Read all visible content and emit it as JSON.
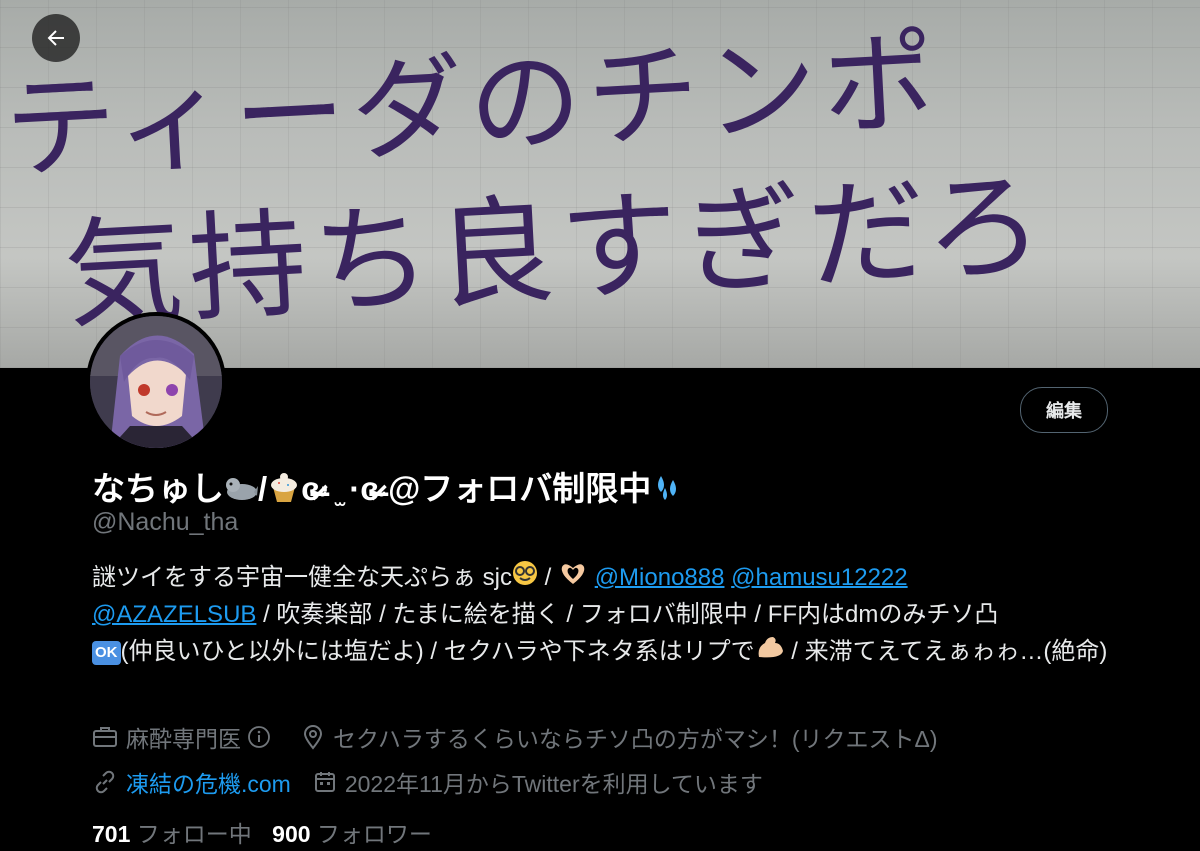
{
  "banner": {
    "line1": "ティーダのチンポ",
    "line2": "気持ち良すぎだろ"
  },
  "actions": {
    "edit_label": "編集"
  },
  "profile": {
    "name_part1": "なちゅし",
    "name_part2": "/",
    "name_part3": "ɞ̴̶̷· ̫ ·ɞ̴̶̷ @フォロバ制限中",
    "handle": "@Nachu_tha",
    "bio": {
      "t1": "謎ツイをする宇宙一健全な天ぷらぁ sjc",
      "t2": " / ",
      "mention1": "@Miono888",
      "mention2": "@hamusu12222",
      "mention3": "@AZAZELSUB",
      "t3": " / 吹奏楽部 / たまに絵を描く / フォロバ制限中 / FF内はdmのみチソ凸",
      "ok": "OK",
      "t4": "(仲良いひと以外には塩だよ) / セクハラや下ネタ系はリプで",
      "t5": " / 来滞てえてえぁゎゎ…(絶命)"
    },
    "job": "麻酔専門医",
    "location": "セクハラするくらいならチソ凸の方がマシ！(リクエストΔ)",
    "website": "凍結の危機.com",
    "joined": "2022年11月からTwitterを利用しています",
    "following_count": "701",
    "following_label": "フォロー中",
    "followers_count": "900",
    "followers_label": "フォロワー"
  },
  "colors": {
    "background": "#000000",
    "link": "#1d9bf0",
    "muted": "#71767b",
    "text": "#e7e9ea"
  },
  "icons": [
    "back-arrow-icon",
    "briefcase-icon",
    "info-icon",
    "location-pin-icon",
    "link-icon",
    "calendar-icon"
  ]
}
